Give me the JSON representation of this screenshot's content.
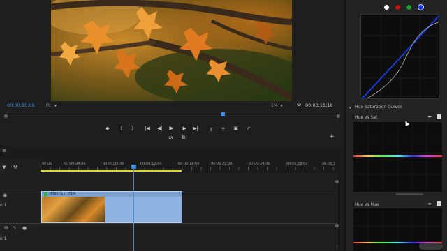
{
  "program": {
    "timecode_current": "00;00;10;08",
    "fit_label": "Fit",
    "resolution": "1/4",
    "timecode_duration": "00;00;15;18"
  },
  "transport": {
    "marker": "◆",
    "in": "{",
    "out": "}",
    "go_in": "|◀",
    "step_back": "◀|",
    "play": "▶",
    "step_fwd": "|▶",
    "go_out": "▶|",
    "lift": "╥",
    "extract": "╤",
    "camera": "▣",
    "export": "↗",
    "fx": "fx",
    "settings": "⧉",
    "add": "+"
  },
  "timeline": {
    "ruler": [
      "00;00",
      "00;00;04;00",
      "00;00;08;00",
      "00;00;12;00",
      "00;00;16;00",
      "00;00;20;00",
      "00;00;24;00",
      "00;00;28;00",
      "00;00;3"
    ],
    "clip_name": "video (11).mp4",
    "track_v1": "o 1",
    "track_a": "o 1",
    "track_m": "M",
    "track_s": "S"
  },
  "lumetri": {
    "dot_colors": [
      "#ffffff",
      "#cc1111",
      "#1a9e2a",
      "#1a3ee6"
    ],
    "section_title": "Hue Saturation Curves",
    "hue_vs_sat": "Hue vs Sat",
    "hue_vs_hue": "Hue vs Hue"
  },
  "colors": {
    "accent": "#3a8ee6",
    "clip_blue": "#8fb3e0",
    "work_area": "#d6d63a"
  },
  "icons": {
    "eyedropper": "eyedropper-icon",
    "checkbox": "checkbox-icon",
    "wrench": "wrench-icon"
  }
}
